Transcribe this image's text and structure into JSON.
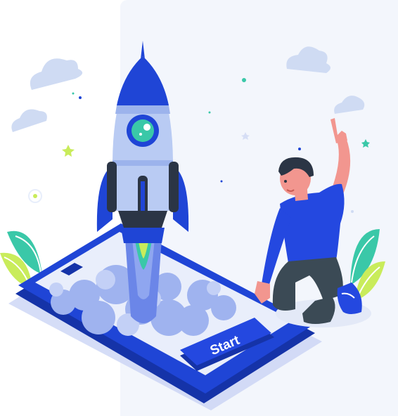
{
  "illustration": {
    "button_label": "Start"
  },
  "colors": {
    "background_panel": "#f3f6fc",
    "primary_blue": "#1f45d6",
    "dark_blue": "#1533a8",
    "rocket_body": "#b9cbf3",
    "smoke": "#9fb3ef",
    "leaf_green": "#3ac8a8",
    "leaf_yellow": "#c9ec5b",
    "skin": "#f2968f",
    "shirt": "#2448e0",
    "pants": "#3b4a55",
    "hair": "#2b3545"
  }
}
